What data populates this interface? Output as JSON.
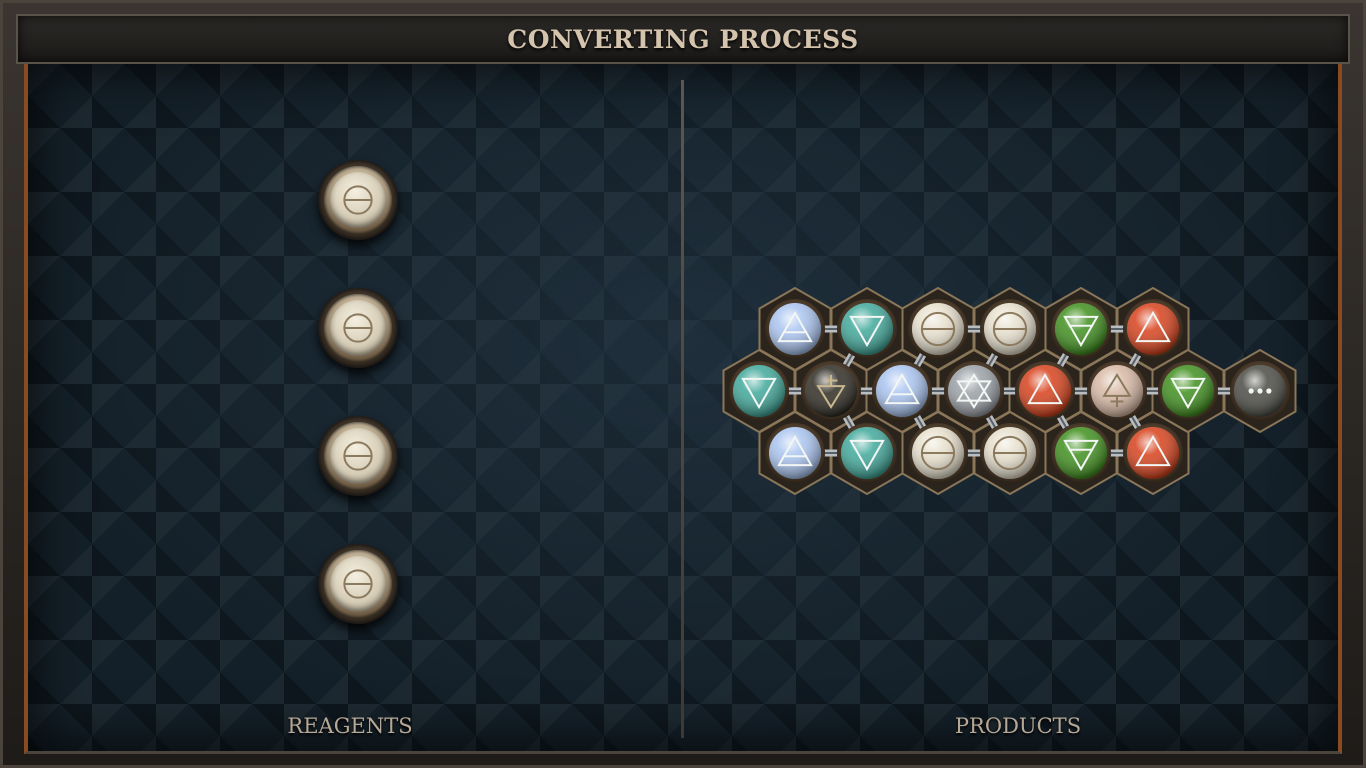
{
  "title": "CONVERTING PROCESS",
  "reagents": {
    "label": "REAGENTS",
    "items": [
      {
        "element": "salt",
        "symbol": "salt-icon"
      },
      {
        "element": "salt",
        "symbol": "salt-icon"
      },
      {
        "element": "salt",
        "symbol": "salt-icon"
      },
      {
        "element": "salt",
        "symbol": "salt-icon"
      }
    ]
  },
  "products": {
    "label": "PRODUCTS",
    "atoms": [
      {
        "element": "air",
        "symbol": "air-icon"
      },
      {
        "element": "water",
        "symbol": "water-icon"
      },
      {
        "element": "salt",
        "symbol": "salt-icon"
      },
      {
        "element": "salt",
        "symbol": "salt-icon"
      },
      {
        "element": "earth",
        "symbol": "earth-icon"
      },
      {
        "element": "fire",
        "symbol": "fire-icon"
      },
      {
        "element": "water",
        "symbol": "water-icon"
      },
      {
        "element": "mors",
        "symbol": "mors-icon"
      },
      {
        "element": "air",
        "symbol": "air-icon"
      },
      {
        "element": "quintessence",
        "symbol": "quintessence-icon"
      },
      {
        "element": "fire",
        "symbol": "fire-icon"
      },
      {
        "element": "vitae",
        "symbol": "vitae-icon"
      },
      {
        "element": "earth",
        "symbol": "earth-icon"
      },
      {
        "element": "repeat",
        "symbol": "ellipsis-icon"
      },
      {
        "element": "air",
        "symbol": "air-icon"
      },
      {
        "element": "water",
        "symbol": "water-icon"
      },
      {
        "element": "salt",
        "symbol": "salt-icon"
      },
      {
        "element": "salt",
        "symbol": "salt-icon"
      },
      {
        "element": "earth",
        "symbol": "earth-icon"
      },
      {
        "element": "fire",
        "symbol": "fire-icon"
      }
    ]
  },
  "colors": {
    "salt": "#e6dfcc",
    "air": "#a9c4f0",
    "water": "#3fa89a",
    "earth": "#3e8f1c",
    "fire": "#d7401a",
    "mors": "#2e2a22",
    "vitae": "#d8b8a4",
    "quintessence": "#9aa0a6",
    "repeat": "#4a4a44"
  }
}
